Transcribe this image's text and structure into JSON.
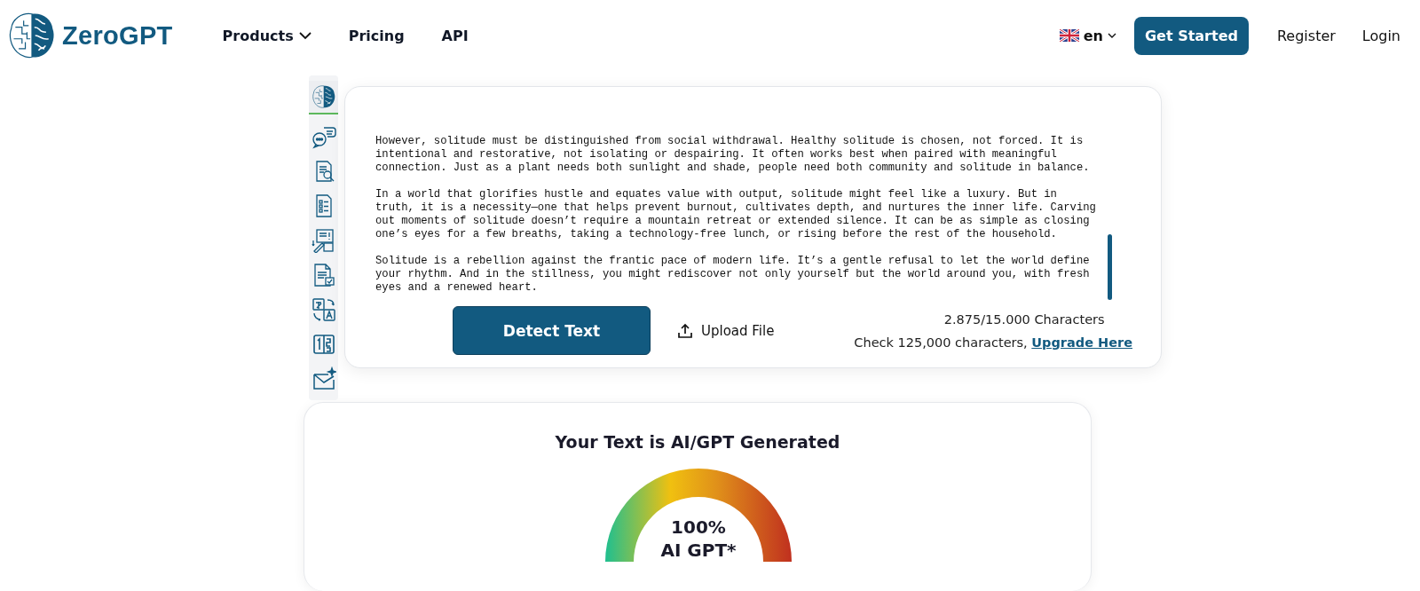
{
  "header": {
    "logo": "ZeroGPT",
    "nav": [
      {
        "label": "Products",
        "dropdown": true
      },
      {
        "label": "Pricing",
        "dropdown": false
      },
      {
        "label": "API",
        "dropdown": false
      }
    ],
    "language": "en",
    "get_started": "Get Started",
    "register": "Register",
    "login": "Login"
  },
  "tools_sidebar": {
    "items": [
      {
        "kind": "brain",
        "selected": true
      },
      {
        "kind": "chat",
        "selected": false
      },
      {
        "kind": "doc-search",
        "selected": false
      },
      {
        "kind": "checklist",
        "selected": false
      },
      {
        "kind": "compare",
        "selected": false
      },
      {
        "kind": "doc-check",
        "selected": false
      },
      {
        "kind": "translate",
        "selected": false
      },
      {
        "kind": "numbers",
        "selected": false
      },
      {
        "kind": "mail",
        "selected": false
      }
    ]
  },
  "editor": {
    "paragraphs": [
      "However, solitude must be distinguished from social withdrawal. Healthy solitude is chosen, not forced. It is intentional and restorative, not isolating or despairing. It often works best when paired with meaningful connection. Just as a plant needs both sunlight and shade, people need both community and solitude in balance.",
      "In a world that glorifies hustle and equates value with output, solitude might feel like a luxury. But in truth, it is a necessity—one that helps prevent burnout, cultivates depth, and nurtures the inner life. Carving out moments of solitude doesn’t require a mountain retreat or extended silence. It can be as simple as closing one’s eyes for a few breaths, taking a technology-free lunch, or rising before the rest of the household.",
      "Solitude is a rebellion against the frantic pace of modern life. It’s a gentle refusal to let the world define your rhythm. And in the stillness, you might rediscover not only yourself but the world around you, with fresh eyes and a renewed heart."
    ],
    "detect_button": "Detect Text",
    "upload_button": "Upload File",
    "char_count": "2.875/15.000 Characters",
    "upgrade_note": "Check 125,000 characters, ",
    "upgrade_link": "Upgrade Here"
  },
  "result": {
    "title": "Your Text is AI/GPT Generated",
    "gauge": {
      "level": 1,
      "percent": "100%",
      "label": "AI GPT*"
    }
  }
}
